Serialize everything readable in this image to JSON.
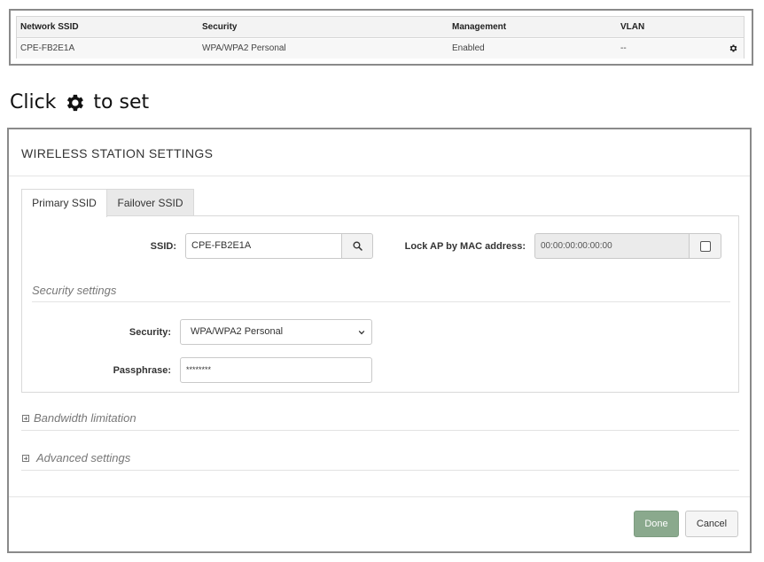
{
  "ssid_table": {
    "headers": [
      "Network SSID",
      "Security",
      "Management",
      "VLAN"
    ],
    "row": {
      "ssid": "CPE-FB2E1A",
      "security": "WPA/WPA2 Personal",
      "management": "Enabled",
      "vlan": "--",
      "action_icon": "gear-icon"
    }
  },
  "instruction": {
    "prefix": "Click",
    "icon": "gear-icon",
    "suffix": "to set"
  },
  "modal": {
    "title": "WIRELESS STATION SETTINGS",
    "tabs": [
      {
        "label": "Primary SSID",
        "active": true
      },
      {
        "label": "Failover SSID",
        "active": false
      }
    ],
    "ssid": {
      "label": "SSID:",
      "value": "CPE-FB2E1A",
      "search_icon": "search-icon"
    },
    "lock_ap": {
      "label": "Lock AP by MAC address:",
      "value": "00:00:00:00:00:00",
      "checked": false
    },
    "security_section": {
      "title": "Security settings",
      "security_label": "Security:",
      "security_value": "WPA/WPA2 Personal",
      "passphrase_label": "Passphrase:",
      "passphrase_value": "********"
    },
    "collapsibles": [
      {
        "label": "Bandwidth limitation",
        "icon": "plus-box-icon"
      },
      {
        "label": "Advanced settings",
        "icon": "plus-box-icon"
      }
    ],
    "footer": {
      "done_label": "Done",
      "cancel_label": "Cancel"
    }
  },
  "colors": {
    "done_button": "#8aa98d",
    "tab_inactive": "#e9e9e9",
    "disabled_input": "#ebebeb",
    "frame_border": "#8a8a8a"
  }
}
